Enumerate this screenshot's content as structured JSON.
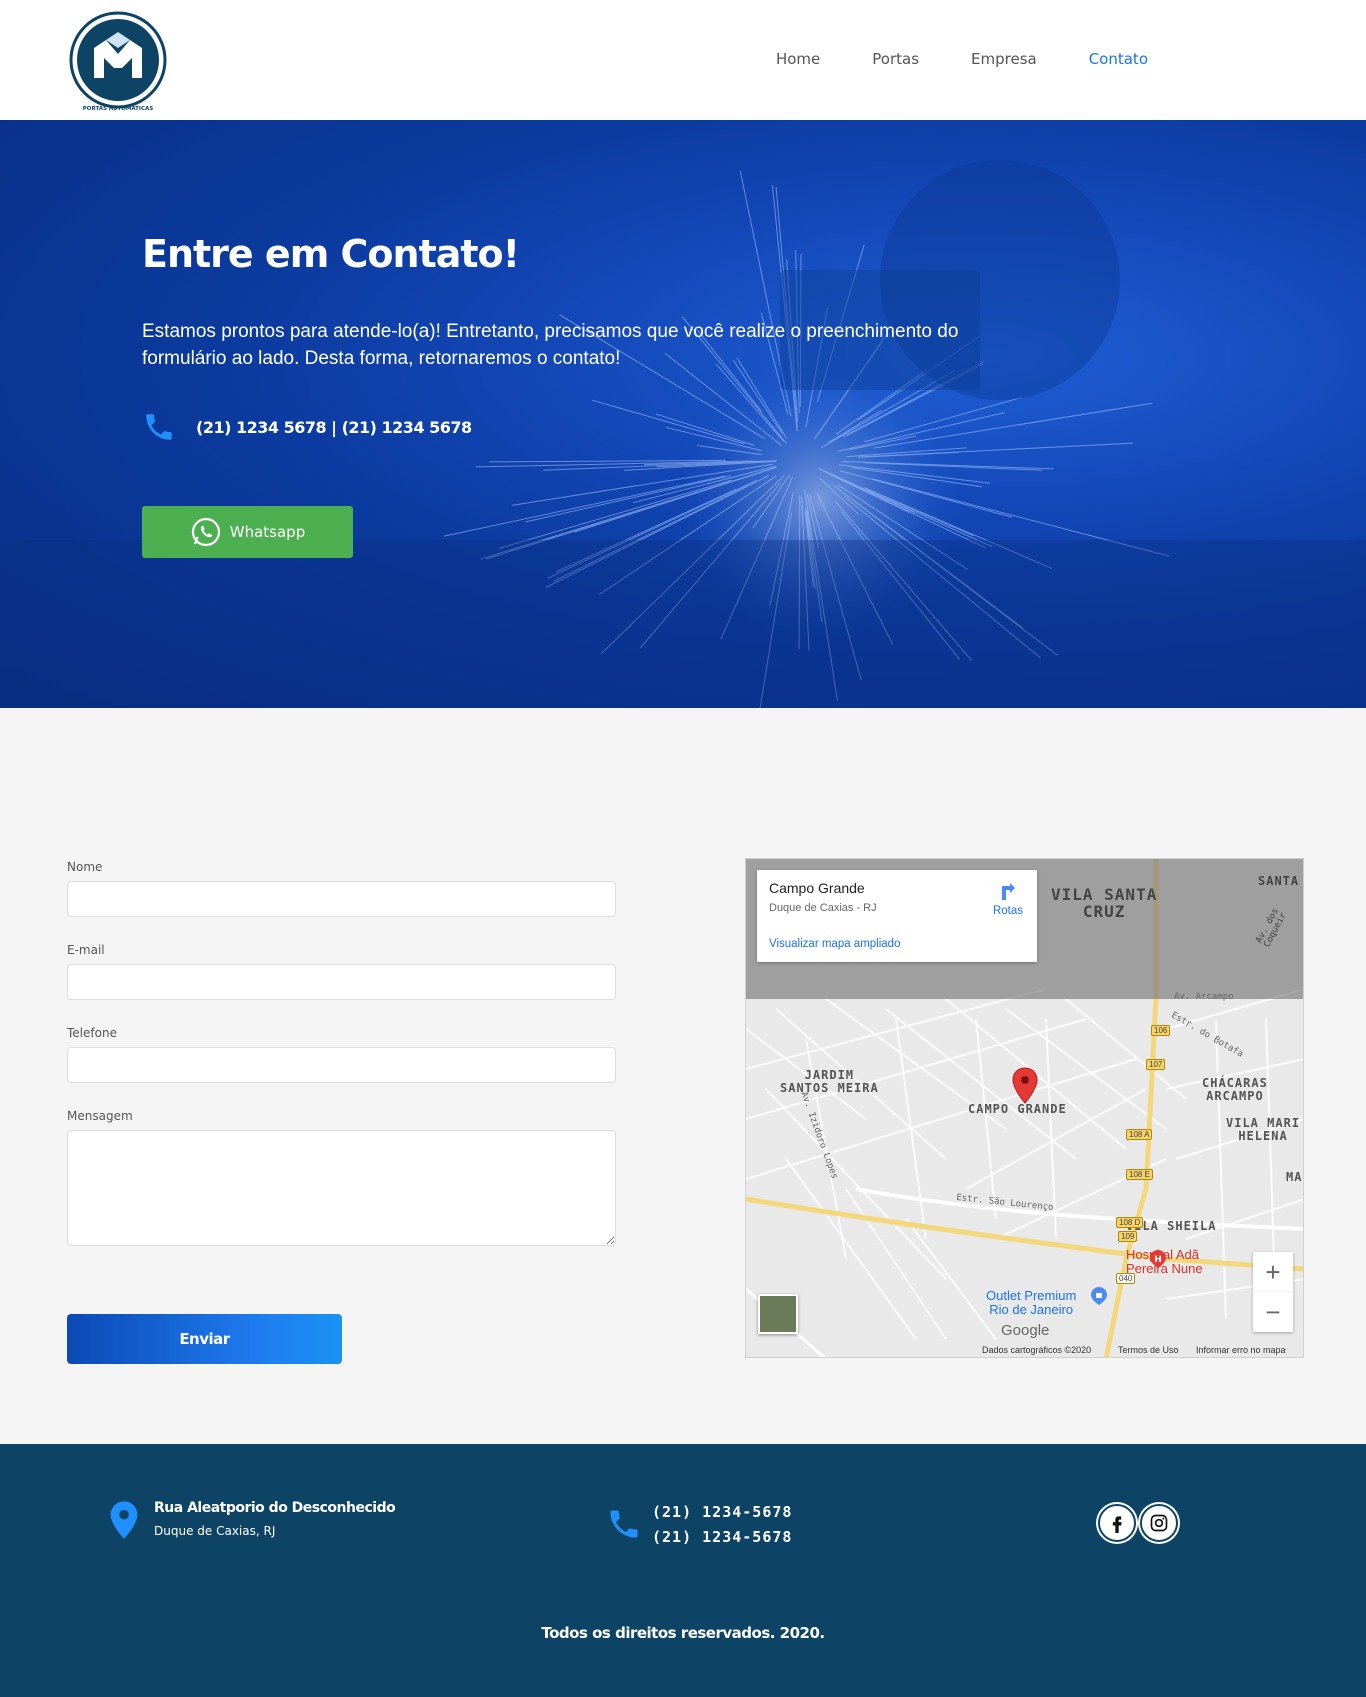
{
  "header": {
    "logo_text": "PORTAS AUTOMÁTICAS",
    "nav": [
      {
        "label": "Home"
      },
      {
        "label": "Portas"
      },
      {
        "label": "Empresa"
      },
      {
        "label": "Contato",
        "active": true
      }
    ]
  },
  "hero": {
    "title": "Entre em Contato!",
    "text": "Estamos prontos para atende-lo(a)! Entretanto, precisamos que você realize o preenchimento do formulário ao lado. Desta forma, retornaremos o contato!",
    "phone": "(21) 1234 5678 | (21) 1234 5678",
    "whatsapp_label": "Whatsapp"
  },
  "form": {
    "name_label": "Nome",
    "email_label": "E-mail",
    "phone_label": "Telefone",
    "message_label": "Mensagem",
    "submit_label": "Enviar"
  },
  "map": {
    "place_name": "Campo Grande",
    "place_address": "Duque de Caxias - RJ",
    "directions_label": "Rotas",
    "larger_map_label": "Visualizar mapa ampliado",
    "labels": {
      "vila_santa_cruz": "VILA SANTA\nCRUZ",
      "santa": "SANTA",
      "jardim": "JARDIM\nSANTOS MEIRA",
      "campo_grande": "CAMPO GRANDE",
      "chacaras": "CHÁCARAS\nARCAMPO",
      "vila_mari": "VILA MARI\nHELENA",
      "vila_sheila": "VILA SHEILA",
      "hospital": "Hospital Adã\nPereira Nune",
      "outlet": "Outlet Premium\nRio de Janeiro",
      "av_arcampo": "Av. Arcampo",
      "estr_botafa": "Estr. do Botafa",
      "estr_sao_lourenco": "Estr. São Lourenço",
      "av_izidoro": "Av. Izidoro Lopes",
      "av_coqueiros": "Av. dos Coqueir",
      "ma": "MA"
    },
    "route_shields": [
      "106",
      "107",
      "108 A",
      "108 E",
      "108 D",
      "109",
      "040"
    ],
    "attribution": "Dados cartográficos ©2020",
    "terms": "Termos de Uso",
    "report": "Informar erro no mapa",
    "google": "Google",
    "zoom_in": "+",
    "zoom_out": "−"
  },
  "footer": {
    "address_line1": "Rua Aleatporio do Desconhecido",
    "address_line2": "Duque de Caxias, RJ",
    "phone1": "(21) 1234-5678",
    "phone2": "(21) 1234-5678",
    "copyright": "Todos os direitos reservados. 2020."
  },
  "colors": {
    "accent": "#1a73e8",
    "whatsapp": "#4caf50",
    "footer_bg": "#0d4465",
    "hero_bg": "#0b3a9e"
  },
  "icons": [
    "phone-icon",
    "whatsapp-icon",
    "location-pin-icon",
    "facebook-icon",
    "instagram-icon",
    "directions-icon",
    "map-marker-icon"
  ]
}
